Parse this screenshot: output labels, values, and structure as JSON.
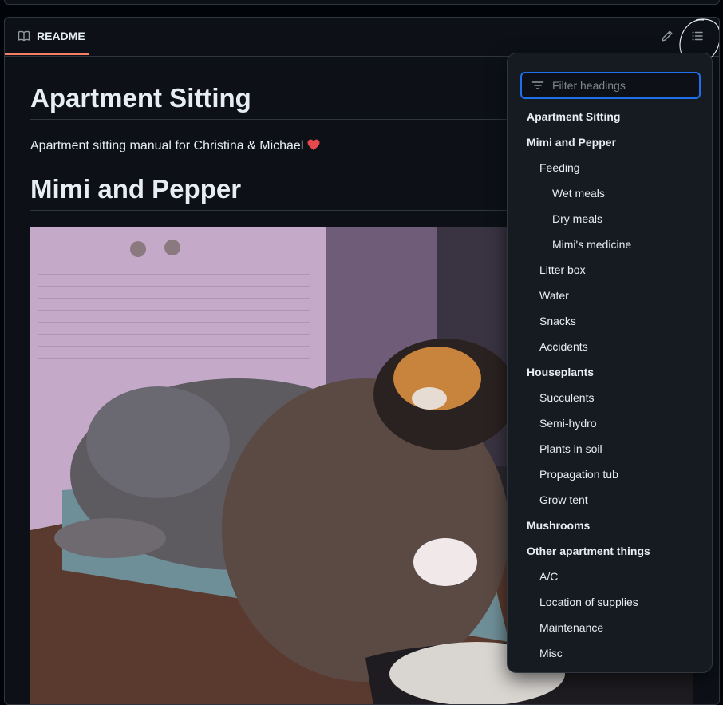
{
  "readme": {
    "tab_label": "README",
    "title": "Apartment Sitting",
    "intro": "Apartment sitting manual for Christina & Michael",
    "section_title": "Mimi and Pepper"
  },
  "outline": {
    "filter_placeholder": "Filter headings",
    "items": [
      {
        "label": "Apartment Sitting",
        "level": 1
      },
      {
        "label": "Mimi and Pepper",
        "level": 1
      },
      {
        "label": "Feeding",
        "level": 2
      },
      {
        "label": "Wet meals",
        "level": 3
      },
      {
        "label": "Dry meals",
        "level": 3
      },
      {
        "label": "Mimi's medicine",
        "level": 3
      },
      {
        "label": "Litter box",
        "level": 2
      },
      {
        "label": "Water",
        "level": 2
      },
      {
        "label": "Snacks",
        "level": 2
      },
      {
        "label": "Accidents",
        "level": 2
      },
      {
        "label": "Houseplants",
        "level": 1
      },
      {
        "label": "Succulents",
        "level": 2
      },
      {
        "label": "Semi-hydro",
        "level": 2
      },
      {
        "label": "Plants in soil",
        "level": 2
      },
      {
        "label": "Propagation tub",
        "level": 2
      },
      {
        "label": "Grow tent",
        "level": 2
      },
      {
        "label": "Mushrooms",
        "level": 1
      },
      {
        "label": "Other apartment things",
        "level": 1
      },
      {
        "label": "A/C",
        "level": 2
      },
      {
        "label": "Location of supplies",
        "level": 2
      },
      {
        "label": "Maintenance",
        "level": 2
      },
      {
        "label": "Misc",
        "level": 2
      }
    ]
  },
  "icons": {
    "readme_tab": "book-icon",
    "edit": "pencil-icon",
    "outline": "list-unordered-icon",
    "filter": "filter-icon",
    "heart": "heart-icon"
  },
  "colors": {
    "background": "#0d1117",
    "border": "#30363d",
    "accent_underline": "#f78166",
    "focus_blue": "#1f6feb",
    "heart_red": "#e5484d"
  }
}
